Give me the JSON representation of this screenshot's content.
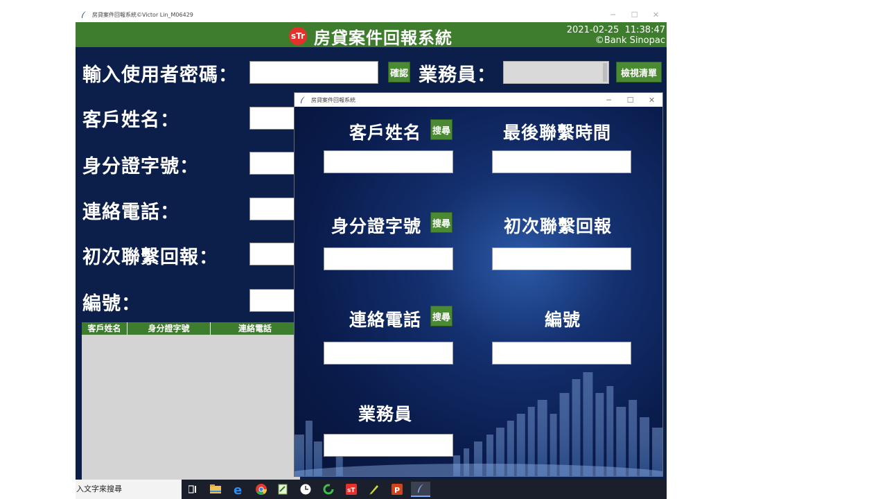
{
  "main_window": {
    "title": "房貸案件回報系統©Victor Lin_M06429",
    "banner": {
      "logo_text": "sTr",
      "title": "房貸案件回報系統",
      "date": "2021-02-25",
      "time": "11:38:47",
      "copyright": "©Bank Sinopac"
    },
    "password_label": "輸入使用者密碼：",
    "confirm_button": "確認",
    "staff_label": "業務員：",
    "view_list_button": "檢視清單",
    "labels": {
      "customer_name": "客戶姓名：",
      "id_number": "身分證字號：",
      "phone": "連絡電話：",
      "first_contact": "初次聯繫回報：",
      "number": "編號："
    },
    "table": {
      "columns": [
        "客戶姓名",
        "身分證字號",
        "連絡電話"
      ]
    }
  },
  "child_window": {
    "title": "房貸案件回報系統",
    "fields": {
      "customer_name": "客戶姓名",
      "last_contact_time": "最後聯繫時間",
      "id_number": "身分證字號",
      "first_contact": "初次聯繫回報",
      "phone": "連絡電話",
      "number": "編號",
      "staff": "業務員"
    },
    "search_button": "搜尋"
  },
  "taskbar": {
    "search_placeholder": "入文字來搜尋",
    "pinned_icons": [
      "task-view-icon",
      "file-explorer-icon",
      "edge-icon",
      "chrome-icon",
      "notepad-icon",
      "clock-icon",
      "loading-ring-icon",
      "sinopac-app-icon",
      "pen-app-icon",
      "powerpoint-icon",
      "feather-app-icon"
    ]
  },
  "colors": {
    "banner_green": "#3f7d2e",
    "main_bg": "#0c1e4a",
    "button_green": "#4a8a32",
    "logo_red": "#e5312b"
  }
}
